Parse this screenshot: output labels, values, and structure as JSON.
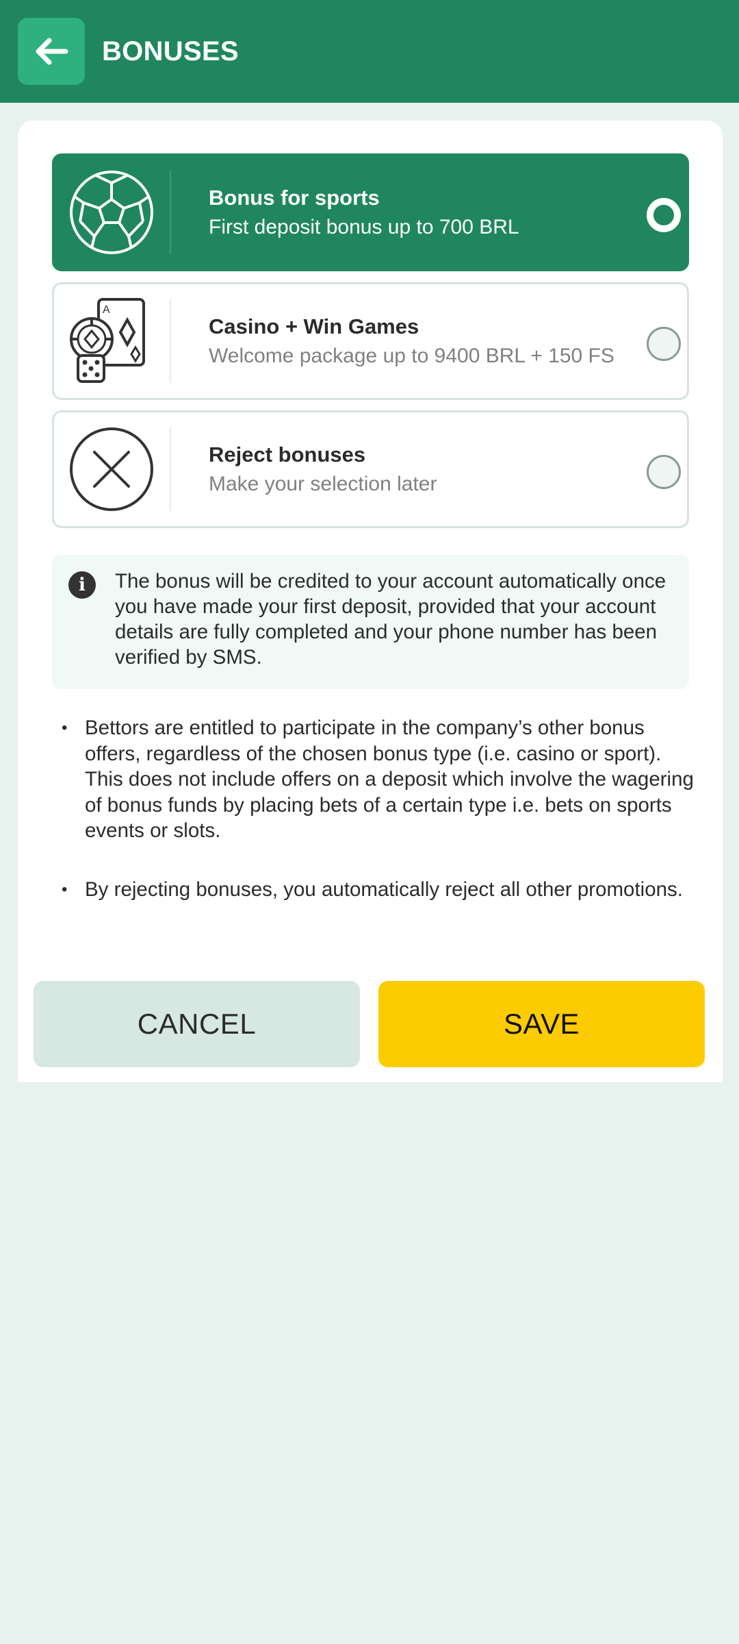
{
  "header": {
    "title": "BONUSES",
    "back_icon": "arrow-left-icon"
  },
  "options": [
    {
      "title": "Bonus for sports",
      "subtitle": "First deposit bonus up to 700 BRL",
      "icon": "soccer-ball-icon",
      "selected": true
    },
    {
      "title": "Casino + Win Games",
      "subtitle": "Welcome package up to 9400 BRL + 150 FS",
      "icon": "casino-cards-dice-icon",
      "selected": false
    },
    {
      "title": "Reject bonuses",
      "subtitle": "Make your selection later",
      "icon": "close-circle-icon",
      "selected": false
    }
  ],
  "info": {
    "icon": "info-icon",
    "text": "The bonus will be credited to your account automatically once you have made your first deposit, provided that your account details are fully completed and your phone number has been verified by SMS."
  },
  "notes": [
    "Bettors are entitled to participate in the company’s other bonus offers, regardless of the chosen bonus type (i.e. casino or sport). This does not include offers on a deposit which involve the wagering of bonus funds by placing bets of a certain type i.e. bets on sports events or slots.",
    "By rejecting bonuses, you automatically reject all other promotions."
  ],
  "actions": {
    "cancel_label": "CANCEL",
    "save_label": "SAVE"
  },
  "colors": {
    "brand_green": "#208660",
    "back_button": "#2eb07f",
    "save_yellow": "#fdcc00",
    "cancel_bg": "#d6e8e1",
    "page_bg": "#e7f1ed"
  }
}
